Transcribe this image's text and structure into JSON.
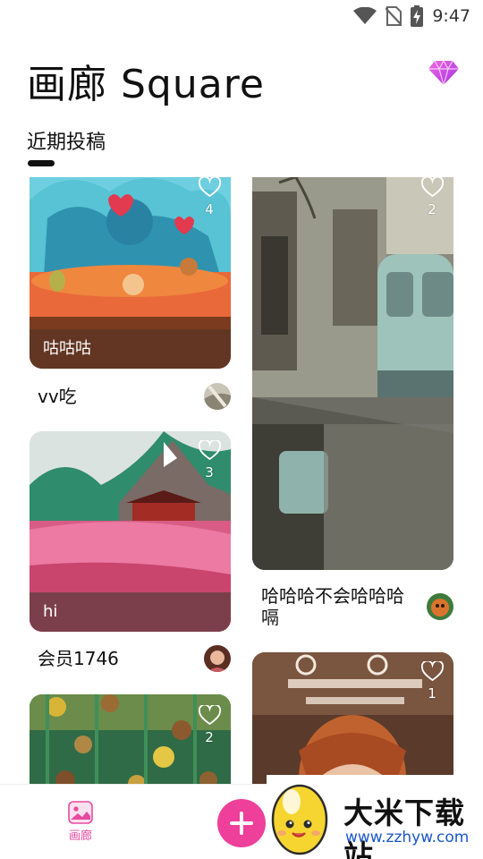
{
  "status_bar": {
    "time": "9:47",
    "icons": [
      "wifi-icon",
      "no-sim-icon",
      "battery-charging-icon"
    ]
  },
  "header": {
    "title": "画廊 Square",
    "vip_icon": "diamond-icon",
    "section_title": "近期投稿"
  },
  "posts": [
    {
      "caption": "咕咕咕",
      "author": "vv吃",
      "likes": "4"
    },
    {
      "caption": "hi",
      "author": "会员1746",
      "likes": "3"
    },
    {
      "caption": "",
      "author": "",
      "likes": "2"
    },
    {
      "caption": "",
      "author": "哈哈哈不会哈哈哈嗝",
      "likes": "2"
    },
    {
      "caption": "",
      "author": "",
      "likes": "1"
    }
  ],
  "bottom_nav": {
    "gallery_label": "画廊",
    "gallery_icon": "gallery-icon",
    "add_icon": "plus-icon"
  },
  "watermark": {
    "name": "大米下载站",
    "url": "www.zzhyw.com"
  },
  "colors": {
    "accent": "#ee3f9a",
    "nav_active": "#e64aa0",
    "caption_bar": "#50322899"
  }
}
